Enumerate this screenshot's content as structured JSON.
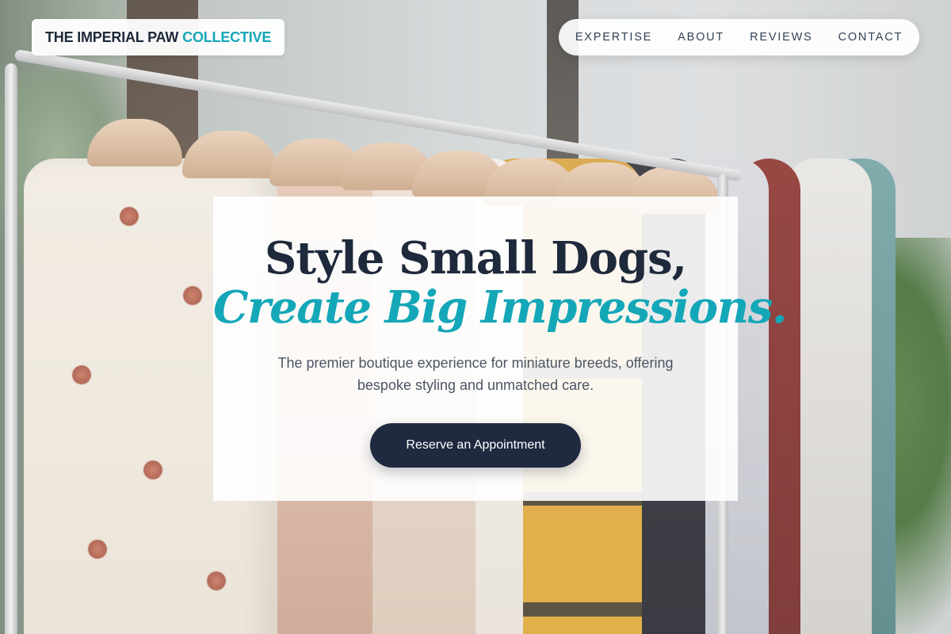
{
  "brand": {
    "name_main": "THE IMPERIAL PAW",
    "name_accent": "COLLECTIVE"
  },
  "nav": {
    "items": [
      {
        "label": "EXPERTISE"
      },
      {
        "label": "ABOUT"
      },
      {
        "label": "REVIEWS"
      },
      {
        "label": "CONTACT"
      }
    ]
  },
  "hero": {
    "headline_line1": "Style Small Dogs,",
    "headline_line2": "Create Big Impressions.",
    "subheadline": "The premier boutique experience for miniature breeds, offering bespoke styling and unmatched care.",
    "cta_label": "Reserve an Appointment"
  },
  "colors": {
    "primary_dark": "#1e293b",
    "accent_teal": "#14a7b8",
    "button_bg": "#1f2a40"
  }
}
